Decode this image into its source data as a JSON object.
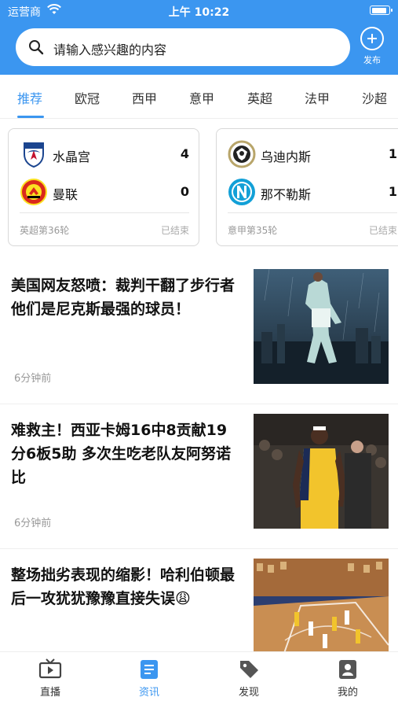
{
  "status_bar": {
    "carrier": "运营商",
    "time": "上午 10:22",
    "battery_level": 0.9
  },
  "search": {
    "placeholder": "请输入感兴趣的内容"
  },
  "publish": {
    "label": "发布"
  },
  "tabs": [
    {
      "label": "推荐",
      "active": true
    },
    {
      "label": "欧冠"
    },
    {
      "label": "西甲"
    },
    {
      "label": "意甲"
    },
    {
      "label": "英超"
    },
    {
      "label": "法甲"
    },
    {
      "label": "沙超"
    }
  ],
  "matches": [
    {
      "home": {
        "name": "水晶宫",
        "score": "4",
        "logo": "crystal-palace-logo"
      },
      "away": {
        "name": "曼联",
        "score": "0",
        "logo": "manchester-united-logo"
      },
      "round": "英超第36轮",
      "status": "已结束"
    },
    {
      "home": {
        "name": "乌迪内斯",
        "score": "1",
        "logo": "udinese-logo"
      },
      "away": {
        "name": "那不勒斯",
        "score": "1",
        "logo": "napoli-logo"
      },
      "round": "意甲第35轮",
      "status": "已结束"
    }
  ],
  "news": [
    {
      "title": "美国网友怒喷：裁判干翻了步行者 他们是尼克斯最强的球员！",
      "time": "6分钟前",
      "image": "knicks-player-rain-poster"
    },
    {
      "title": "难救主！西亚卡姆16中8贡献19分6板5助 多次生吃老队友阿努诺比",
      "time": "6分钟前",
      "image": "pacers-player-43-photo"
    },
    {
      "title": "整场拙劣表现的缩影！哈利伯顿最后一攻犹犹豫豫直接失误😩",
      "time": "",
      "image": "basketball-court-action-photo"
    }
  ],
  "bottom_nav": [
    {
      "label": "直播",
      "icon": "tv-icon"
    },
    {
      "label": "资讯",
      "icon": "news-icon",
      "active": true
    },
    {
      "label": "发现",
      "icon": "tag-icon"
    },
    {
      "label": "我的",
      "icon": "profile-icon"
    }
  ],
  "colors": {
    "primary": "#3b96f0",
    "text": "#111111",
    "muted": "#999999"
  }
}
